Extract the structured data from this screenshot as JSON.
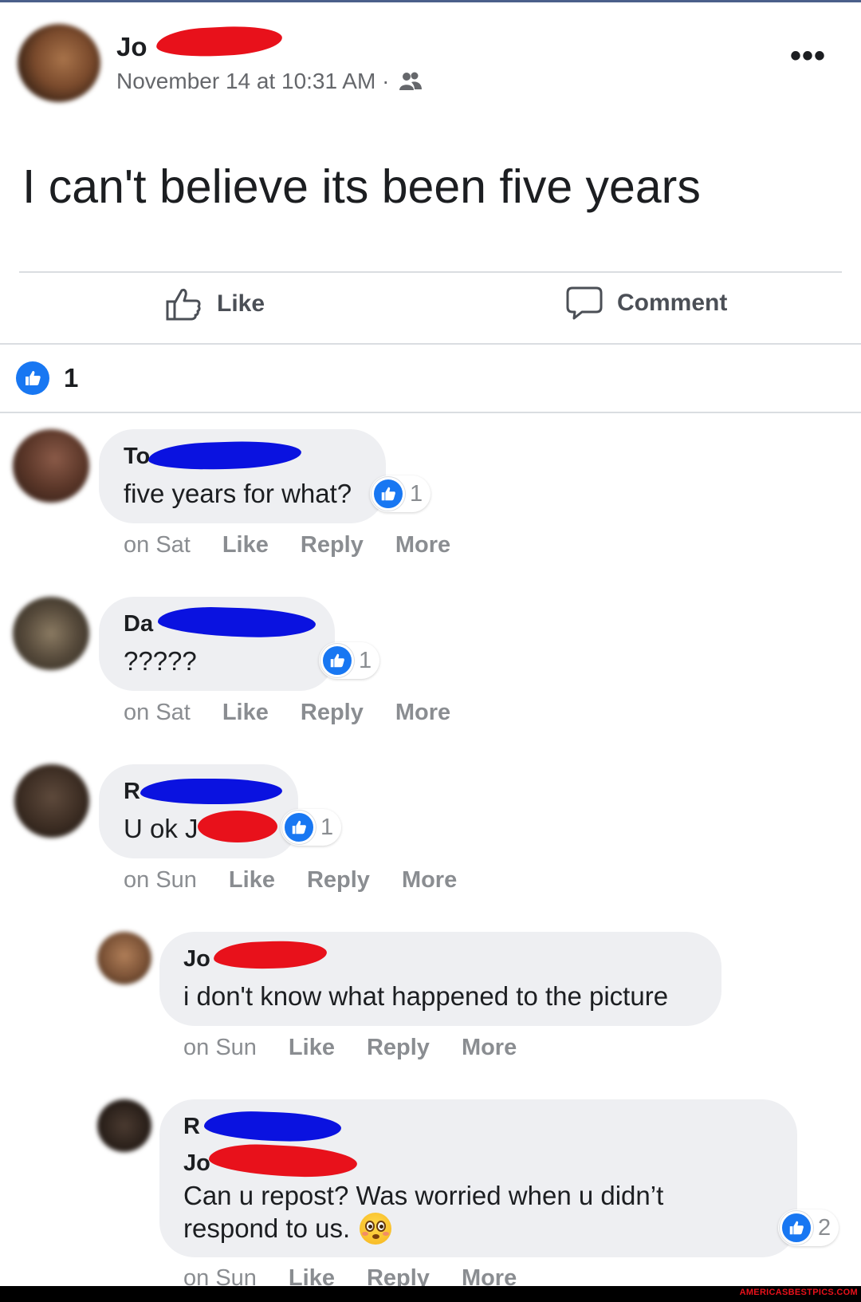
{
  "post": {
    "author_visible": "Jo",
    "timestamp": "November 14 at 10:31 AM ·",
    "audience_icon": "friends-icon",
    "text": "I can't believe its been five years",
    "more_icon": "more-dots-icon"
  },
  "actions": {
    "like_label": "Like",
    "comment_label": "Comment"
  },
  "reactions": {
    "count": "1"
  },
  "comments": [
    {
      "name_visible": "To",
      "text": "five years for what?",
      "reaction_count": "1",
      "time": "on Sat",
      "like": "Like",
      "reply": "Reply",
      "more": "More"
    },
    {
      "name_visible": "Da",
      "text": "?????",
      "reaction_count": "1",
      "time": "on Sat",
      "like": "Like",
      "reply": "Reply",
      "more": "More"
    },
    {
      "name_visible": "R",
      "text": "U ok J",
      "reaction_count": "1",
      "time": "on Sun",
      "like": "Like",
      "reply": "Reply",
      "more": "More"
    }
  ],
  "replies": [
    {
      "name_visible": "Jo",
      "text": "i don't know what happened to the picture",
      "time": "on Sun",
      "like": "Like",
      "reply": "Reply",
      "more": "More"
    },
    {
      "name_visible": "R",
      "mention_visible": "Jo",
      "text_line1": "Can u repost? Was worried when u didn’t",
      "text_line2": "respond to us.",
      "emoji": "flushed-face-emoji",
      "reaction_count": "2",
      "time": "on Sun",
      "like": "Like",
      "reply": "Reply",
      "more": "More"
    }
  ],
  "watermark": "AMERICASBESTPICS.COM",
  "colors": {
    "like_blue": "#1877f2",
    "bubble": "#eeeff2",
    "meta_gray": "#8a8d91",
    "redaction_red": "#e8111b",
    "redaction_blue": "#0a12e0"
  }
}
